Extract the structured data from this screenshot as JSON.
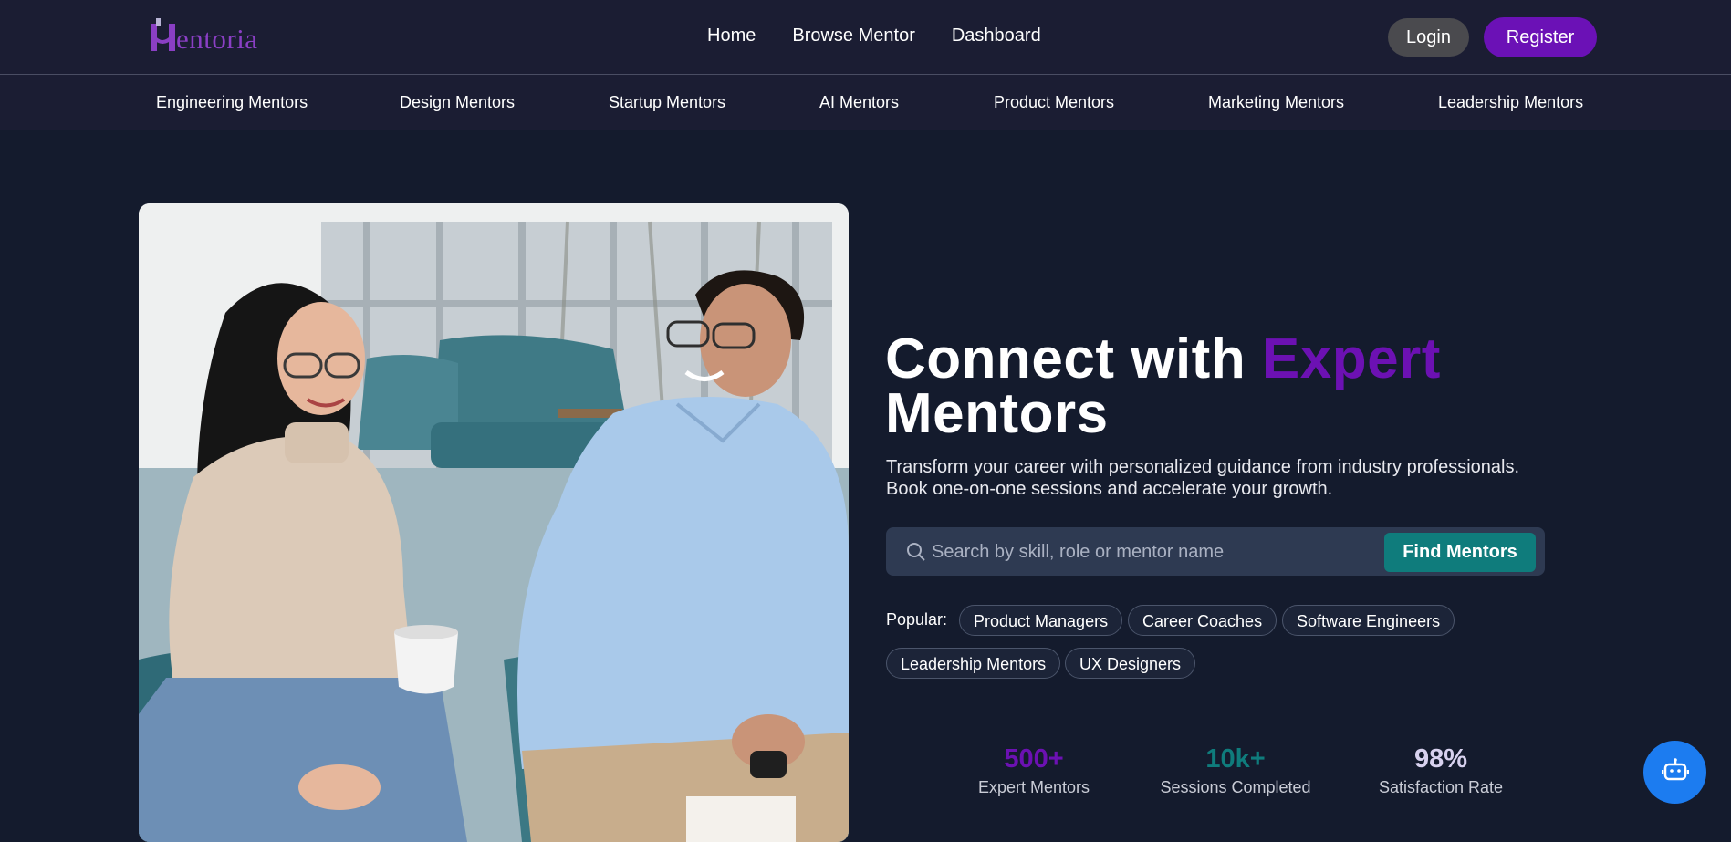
{
  "brand": {
    "name": "entoria",
    "logo_letter": "M",
    "color": "#8a3fc4"
  },
  "nav": {
    "links": [
      "Home",
      "Browse Mentor",
      "Dashboard"
    ],
    "login_label": "Login",
    "register_label": "Register"
  },
  "categories": [
    "Engineering Mentors",
    "Design Mentors",
    "Startup Mentors",
    "AI Mentors",
    "Product Mentors",
    "Marketing Mentors",
    "Leadership Mentors"
  ],
  "hero": {
    "headline_part1": "Connect with ",
    "headline_accent": "Expert",
    "headline_part2": "Mentors",
    "subtitle": "Transform your career with personalized guidance from industry professionals. Book one-on-one sessions and accelerate your growth.",
    "search_placeholder": "Search by skill, role or mentor name",
    "search_value": "",
    "search_button": "Find Mentors",
    "popular_label": "Popular:",
    "popular_tags": [
      "Product Managers",
      "Career Coaches",
      "Software Engineers",
      "Leadership Mentors",
      "UX Designers"
    ]
  },
  "stats": [
    {
      "value": "500+",
      "label": "Expert Mentors",
      "color": "#6c11b3"
    },
    {
      "value": "10k+",
      "label": "Sessions Completed",
      "color": "#0f7c7c"
    },
    {
      "value": "98%",
      "label": "Satisfaction Rate",
      "color": "#d8d2ef"
    }
  ],
  "colors": {
    "accent_purple": "#6c11b3",
    "accent_teal": "#0f7c7c",
    "chat_blue": "#1c7cf0",
    "background": "#141b2d"
  },
  "icons": {
    "search": "search-icon",
    "chatbot": "robot-icon",
    "hero_image": "mentoring-photo"
  }
}
